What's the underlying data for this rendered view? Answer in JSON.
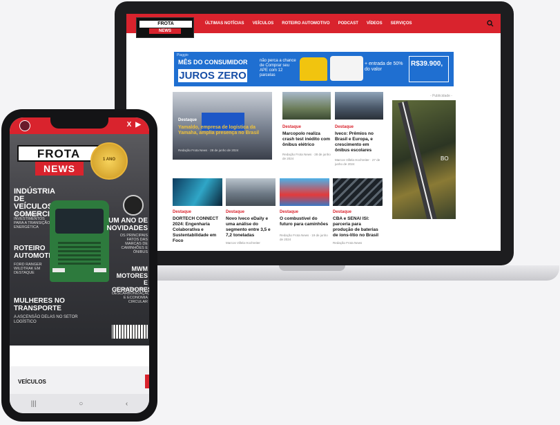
{
  "site": {
    "logo_top": "FROTA",
    "logo_bottom": "NEWS",
    "nav": [
      "ÚLTIMAS NOTÍCIAS",
      "VEÍCULOS",
      "ROTEIRO AUTOMOTIVO",
      "PODCAST",
      "VÍDEOS",
      "SERVIÇOS"
    ]
  },
  "banner": {
    "brand": "Piaggio",
    "headline": "MÊS DO CONSUMIDOR",
    "juros": "JUROS ZERO",
    "offer": "não perca a chance de Comprar seu APE com 12 parcelas",
    "entrada": "+ entrada de 50% do valor",
    "price": "R$39.900,"
  },
  "featured": {
    "tag": "Destaque",
    "title": "Yamaldo, empresa de logística da Yamaha, amplia presença no Brasil",
    "meta": "Redação Frota News · 28 de junho de 2024"
  },
  "top_cards": [
    {
      "tag": "Destaque",
      "title": "Marcopolo realiza crash test inédito com ônibus elétrico",
      "meta": "Redação Frota News · 28 de junho de 2024"
    },
    {
      "tag": "Destaque",
      "title": "Iveco: Prêmios no Brasil e Europa, e crescimento em ônibus escolares",
      "meta": "Marcos Villela Hochreiter · 27 de junho de 2024"
    }
  ],
  "bottom_cards": [
    {
      "tag": "Destaque",
      "title": "DORTECH CONNECT 2024: Engenharia Colaborativa e Sustentabilidade em Foco",
      "meta": ""
    },
    {
      "tag": "Destaque",
      "title": "Novo Iveco eDaily e uma análise do segmento entre 3,5 e 7,2 toneladas",
      "meta": "Marcos Villela Hochreiter"
    },
    {
      "tag": "Destaque",
      "title": "O combustível do futuro para caminhões",
      "meta": "Redação Frota News · 19 de junho de 2024"
    },
    {
      "tag": "Destaque",
      "title": "CBA e SENAI ISI: parceria para produção de baterias de íons-lítio no Brasil",
      "meta": "Redação Frota News"
    }
  ],
  "ad": {
    "label": "- Publicidade -",
    "text": "BO"
  },
  "phone": {
    "cover_frota": "FROTA",
    "cover_news": "NEWS",
    "seal": "1 ANO",
    "left_h1": "INDÚSTRIA DE VEÍCULOS COMERCIAIS",
    "left_s1": "OS CICLOS DE INVESTIMENTOS PARA A TRANSIÇÃO ENERGÉTICA",
    "left_h2": "ROTEIRO AUTOMOTIVO",
    "left_s2": "FORD RANGER WILDTRAK EM DESTAQUE",
    "left_h3": "MULHERES NO TRANSPORTE",
    "left_s3": "A ASCENSÃO DELAS NO SETOR LOGÍSTICO",
    "right_h1": "UM ANO DE NOVIDADES",
    "right_s1": "OS PRINCIPAIS FATOS DAS MARCAS DE CAMINHÕES E ÔNIBUS",
    "right_h2": "MWM MOTORES E GERADORES",
    "right_s2": "SOLUÇÕES PARA DESCARBONIZAÇÃO E ECONOMIA CIRCULAR",
    "section": "VEÍCULOS",
    "nav_icons": [
      "|||",
      "○",
      "‹"
    ]
  }
}
